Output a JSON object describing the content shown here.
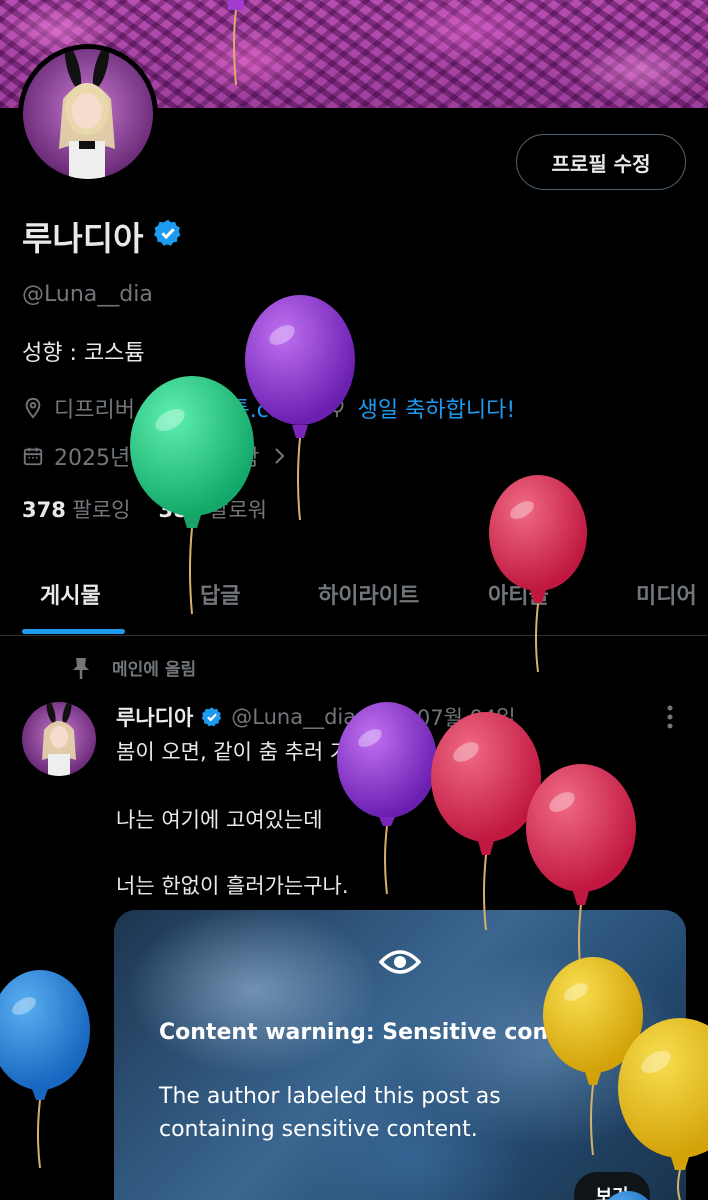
{
  "profile": {
    "name": "루나디아",
    "handle": "@Luna__dia",
    "edit_button": "프로필 수정",
    "bio": "성향 : 코스튬",
    "location": "디프리버",
    "link": "코스튬.com",
    "birthday": "생일 축하합니다!",
    "joined": "2025년 6월에 가입함",
    "following_count": "378",
    "following_label": "팔로잉",
    "followers_count": "382",
    "followers_label": "팔로워"
  },
  "tabs": [
    {
      "label": "게시물",
      "active": true
    },
    {
      "label": "답글",
      "active": false
    },
    {
      "label": "하이라이트",
      "active": false
    },
    {
      "label": "아티클",
      "active": false
    },
    {
      "label": "미디어",
      "active": false
    }
  ],
  "post": {
    "pinned_label": "메인에 올림",
    "author_name": "루나디아",
    "author_handle": "@Luna__dia",
    "date": "25년 07월 04일",
    "lines": [
      "봄이 오면, 같이 춤 추러 가자.",
      "나는 여기에 고여있는데",
      "너는 한없이 흘러가는구나."
    ],
    "warning": {
      "title": "Content warning: Sensitive content",
      "description": "The author labeled this post as containing sensitive content.",
      "show_button": "보기"
    }
  },
  "icons": [
    "verified-badge-icon",
    "location-icon",
    "link-icon",
    "balloon-icon",
    "calendar-icon",
    "chevron-right-icon",
    "pin-icon",
    "more-options-icon",
    "eye-icon"
  ],
  "colors": {
    "background": "#000000",
    "accent": "#1d9bf0",
    "secondary_text": "#71767b",
    "primary_text": "#e7e9ea"
  }
}
